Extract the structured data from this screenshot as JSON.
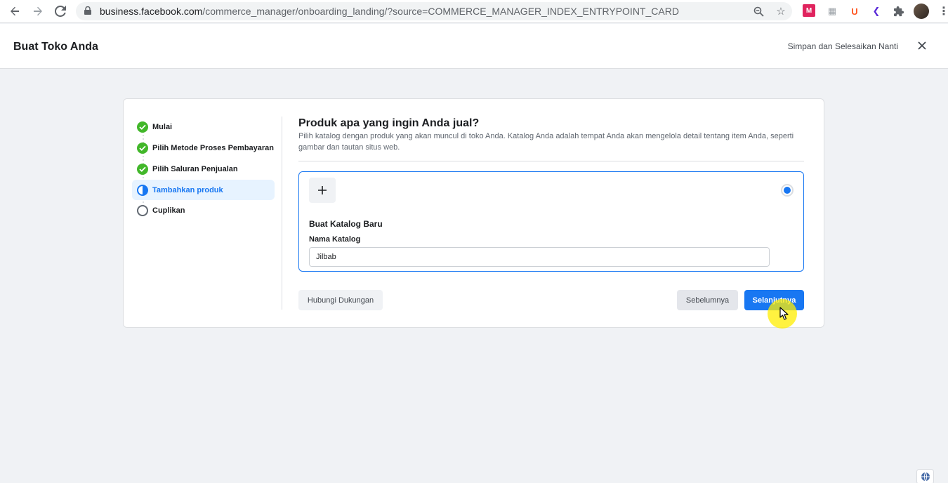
{
  "browser": {
    "url_host": "business.facebook.com",
    "url_rest": "/commerce_manager/onboarding_landing/?source=COMMERCE_MANAGER_INDEX_ENTRYPOINT_CARD",
    "icons": [
      "back-icon",
      "forward-icon",
      "reload-icon",
      "lock-icon",
      "zoom-icon",
      "star-icon",
      "extensions-icon",
      "profile-avatar"
    ],
    "extensions": [
      {
        "name": "ext-red-icon",
        "glyph": "M",
        "color": "#e0245e"
      },
      {
        "name": "ext-doc-icon",
        "glyph": "▦",
        "color": "#9aa0a6"
      },
      {
        "name": "ext-u-icon",
        "glyph": "U",
        "color": "#ff5722"
      },
      {
        "name": "ext-purple-icon",
        "glyph": "❮",
        "color": "#5b2bd8"
      }
    ]
  },
  "header": {
    "title": "Buat Toko Anda",
    "save_later": "Simpan dan Selesaikan Nanti",
    "close_icon": "close-icon"
  },
  "steps": [
    {
      "label": "Mulai",
      "status": "done"
    },
    {
      "label": "Pilih Metode Proses Pembayaran",
      "status": "done"
    },
    {
      "label": "Pilih Saluran Penjualan",
      "status": "done"
    },
    {
      "label": "Tambahkan produk",
      "status": "current"
    },
    {
      "label": "Cuplikan",
      "status": "pending"
    }
  ],
  "main": {
    "title": "Produk apa yang ingin Anda jual?",
    "description": "Pilih katalog dengan produk yang akan muncul di toko Anda. Katalog Anda adalah tempat Anda akan mengelola detail tentang item Anda, seperti gambar dan tautan situs web.",
    "option": {
      "title": "Buat Katalog Baru",
      "field_label": "Nama Katalog",
      "field_value": "Jilbab",
      "selected": true
    },
    "buttons": {
      "support": "Hubungi Dukungan",
      "prev": "Sebelumnya",
      "next": "Selanjutnya"
    }
  },
  "colors": {
    "accent": "#1877f2",
    "done": "#42b72a",
    "page_bg": "#f0f2f5"
  }
}
